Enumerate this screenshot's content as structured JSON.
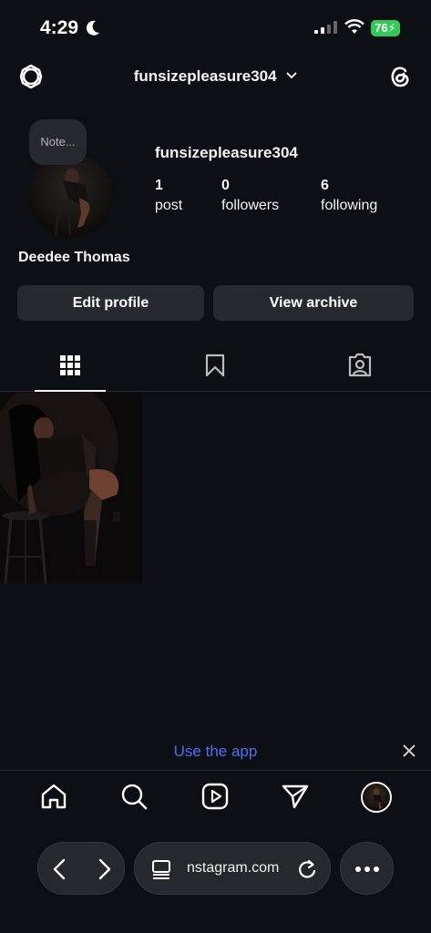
{
  "status_bar": {
    "time": "4:29",
    "battery": "76",
    "battery_color": "#34c759"
  },
  "header": {
    "username": "funsizepleasure304",
    "left_icon": "settings-icon",
    "right_icon": "threads-icon"
  },
  "profile": {
    "note_placeholder": "Note...",
    "username": "funsizepleasure304",
    "full_name": "Deedee Thomas",
    "stats": [
      {
        "count": "1",
        "label": "post"
      },
      {
        "count": "0",
        "label": "followers"
      },
      {
        "count": "6",
        "label": "following"
      }
    ],
    "buttons": {
      "edit": "Edit profile",
      "archive": "View archive"
    }
  },
  "tabs": [
    {
      "name": "posts-grid",
      "icon": "grid-icon",
      "active": true
    },
    {
      "name": "saved",
      "icon": "bookmark-icon",
      "active": false
    },
    {
      "name": "tagged",
      "icon": "tagged-icon",
      "active": false
    }
  ],
  "banner": {
    "link": "Use the app",
    "accent": "#4c6ef5"
  },
  "bottom_nav": [
    "home-icon",
    "search-icon",
    "reels-icon",
    "direct-icon",
    "profile-avatar"
  ],
  "browser": {
    "url": "nstagram.com"
  }
}
